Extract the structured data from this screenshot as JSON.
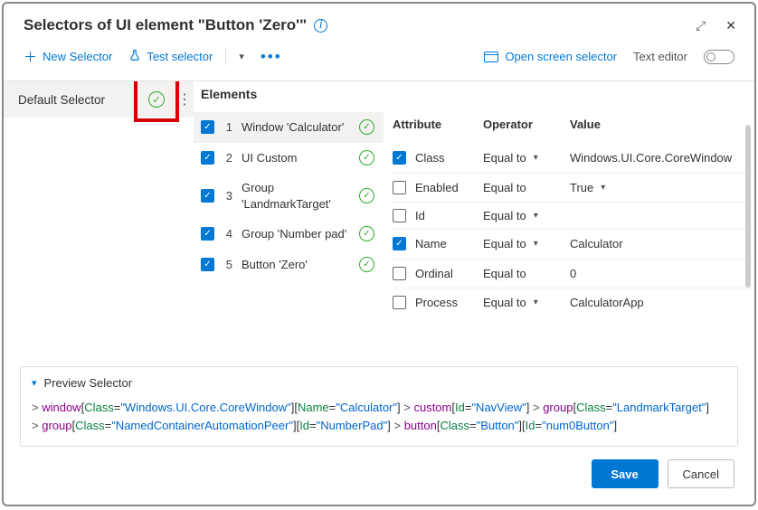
{
  "header": {
    "title": "Selectors of UI element \"Button 'Zero'\""
  },
  "toolbar": {
    "new_selector": "New Selector",
    "test_selector": "Test selector",
    "open_screen": "Open screen selector",
    "text_editor": "Text editor"
  },
  "left": {
    "default_selector": "Default Selector"
  },
  "elements": {
    "title": "Elements",
    "items": [
      {
        "idx": "1",
        "name": "Window 'Calculator'",
        "checked": true,
        "ok": true,
        "selected": true
      },
      {
        "idx": "2",
        "name": "UI Custom",
        "checked": true,
        "ok": true,
        "selected": false
      },
      {
        "idx": "3",
        "name": "Group 'LandmarkTarget'",
        "checked": true,
        "ok": true,
        "selected": false
      },
      {
        "idx": "4",
        "name": "Group 'Number pad'",
        "checked": true,
        "ok": true,
        "selected": false
      },
      {
        "idx": "5",
        "name": "Button 'Zero'",
        "checked": true,
        "ok": true,
        "selected": false
      }
    ]
  },
  "attributes": {
    "head_attr": "Attribute",
    "head_op": "Operator",
    "head_val": "Value",
    "rows": [
      {
        "checked": true,
        "attr": "Class",
        "op": "Equal to",
        "op_chev": true,
        "val": "Windows.UI.Core.CoreWindow",
        "val_chev": false
      },
      {
        "checked": false,
        "attr": "Enabled",
        "op": "Equal to",
        "op_chev": false,
        "val": "True",
        "val_chev": true
      },
      {
        "checked": false,
        "attr": "Id",
        "op": "Equal to",
        "op_chev": true,
        "val": "",
        "val_chev": false
      },
      {
        "checked": true,
        "attr": "Name",
        "op": "Equal to",
        "op_chev": true,
        "val": "Calculator",
        "val_chev": false
      },
      {
        "checked": false,
        "attr": "Ordinal",
        "op": "Equal to",
        "op_chev": false,
        "val": "0",
        "val_chev": false
      },
      {
        "checked": false,
        "attr": "Process",
        "op": "Equal to",
        "op_chev": true,
        "val": "CalculatorApp",
        "val_chev": false
      }
    ]
  },
  "preview": {
    "title": "Preview Selector",
    "tokens": [
      {
        "t": "gt",
        "v": "> "
      },
      {
        "t": "el",
        "v": "window"
      },
      {
        "t": "br",
        "v": "["
      },
      {
        "t": "key",
        "v": "Class"
      },
      {
        "t": "eq",
        "v": "="
      },
      {
        "t": "val",
        "v": "\"Windows.UI.Core.CoreWindow\""
      },
      {
        "t": "br",
        "v": "]"
      },
      {
        "t": "br",
        "v": "["
      },
      {
        "t": "key",
        "v": "Name"
      },
      {
        "t": "eq",
        "v": "="
      },
      {
        "t": "val",
        "v": "\"Calculator\""
      },
      {
        "t": "br",
        "v": "]"
      },
      {
        "t": "gt",
        "v": " > "
      },
      {
        "t": "el",
        "v": "custom"
      },
      {
        "t": "br",
        "v": "["
      },
      {
        "t": "key",
        "v": "Id"
      },
      {
        "t": "eq",
        "v": "="
      },
      {
        "t": "val",
        "v": "\"NavView\""
      },
      {
        "t": "br",
        "v": "]"
      },
      {
        "t": "gt",
        "v": " > "
      },
      {
        "t": "el",
        "v": "group"
      },
      {
        "t": "br",
        "v": "["
      },
      {
        "t": "key",
        "v": "Class"
      },
      {
        "t": "eq",
        "v": "="
      },
      {
        "t": "val",
        "v": "\"LandmarkTarget\""
      },
      {
        "t": "br",
        "v": "]"
      },
      {
        "t": "nl",
        "v": ""
      },
      {
        "t": "gt",
        "v": "> "
      },
      {
        "t": "el",
        "v": "group"
      },
      {
        "t": "br",
        "v": "["
      },
      {
        "t": "key",
        "v": "Class"
      },
      {
        "t": "eq",
        "v": "="
      },
      {
        "t": "val",
        "v": "\"NamedContainerAutomationPeer\""
      },
      {
        "t": "br",
        "v": "]"
      },
      {
        "t": "br",
        "v": "["
      },
      {
        "t": "key",
        "v": "Id"
      },
      {
        "t": "eq",
        "v": "="
      },
      {
        "t": "val",
        "v": "\"NumberPad\""
      },
      {
        "t": "br",
        "v": "]"
      },
      {
        "t": "gt",
        "v": " > "
      },
      {
        "t": "el",
        "v": "button"
      },
      {
        "t": "br",
        "v": "["
      },
      {
        "t": "key",
        "v": "Class"
      },
      {
        "t": "eq",
        "v": "="
      },
      {
        "t": "val",
        "v": "\"Button\""
      },
      {
        "t": "br",
        "v": "]"
      },
      {
        "t": "br",
        "v": "["
      },
      {
        "t": "key",
        "v": "Id"
      },
      {
        "t": "eq",
        "v": "="
      },
      {
        "t": "val",
        "v": "\"num0Button\""
      },
      {
        "t": "br",
        "v": "]"
      }
    ]
  },
  "footer": {
    "save": "Save",
    "cancel": "Cancel"
  }
}
